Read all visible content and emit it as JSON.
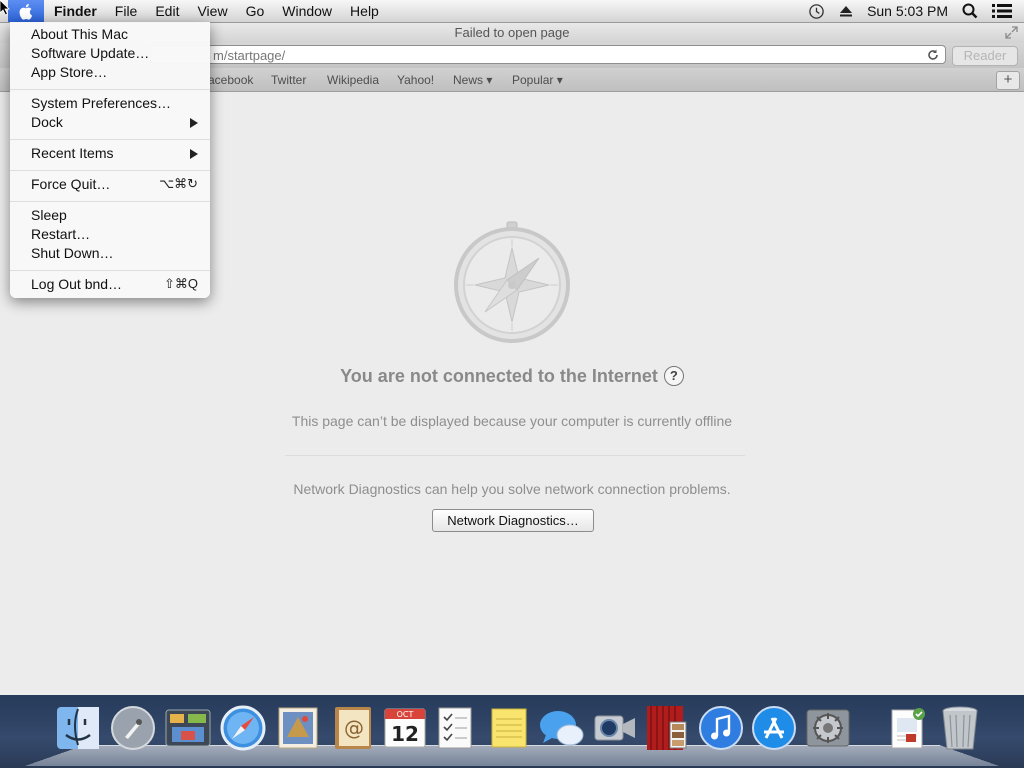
{
  "menubar": {
    "apple_icon": "apple-icon",
    "items": [
      "Finder",
      "File",
      "Edit",
      "View",
      "Go",
      "Window",
      "Help"
    ],
    "status": {
      "time_machine_icon": "time-machine-icon",
      "eject_icon": "eject-icon",
      "clock": "Sun 5:03 PM",
      "spotlight_icon": "spotlight-icon",
      "notifications_icon": "list-icon"
    }
  },
  "apple_menu": {
    "items": [
      {
        "label": "About This Mac"
      },
      {
        "label": "Software Update…"
      },
      {
        "label": "App Store…"
      },
      {
        "label": "System Preferences…"
      },
      {
        "label": "Dock",
        "submenu": true
      },
      {
        "label": "Recent Items",
        "submenu": true
      },
      {
        "label": "Force Quit…",
        "shortcut": "⌥⌘↻"
      },
      {
        "label": "Sleep"
      },
      {
        "label": "Restart…"
      },
      {
        "label": "Shut Down…"
      },
      {
        "label": "Log Out bnd…",
        "shortcut": "⇧⌘Q"
      }
    ]
  },
  "safari": {
    "window_title": "Failed to open page",
    "url_visible": "m/startpage/",
    "reader_label": "Reader",
    "bookmarks": [
      "acebook",
      "Twitter",
      "Wikipedia",
      "Yahoo!",
      "News ▾",
      "Popular ▾"
    ],
    "new_tab_label": "+"
  },
  "error_page": {
    "title": "You are not connected to the Internet",
    "help_label": "?",
    "description": "This page can’t be displayed because your computer is currently offline",
    "diagnostics_text": "Network Diagnostics can help you solve network connection problems.",
    "diagnostics_button": "Network Diagnostics…"
  },
  "dock": {
    "items": [
      "finder-icon",
      "launchpad-icon",
      "mission-control-icon",
      "safari-icon",
      "mail-icon",
      "contacts-icon",
      "calendar-icon",
      "reminders-icon",
      "notes-icon",
      "messages-icon",
      "facetime-icon",
      "photo-booth-icon",
      "itunes-icon",
      "app-store-icon",
      "system-preferences-icon",
      "preview-document-icon",
      "trash-icon"
    ],
    "calendar_month": "OCT",
    "calendar_day": "12"
  }
}
